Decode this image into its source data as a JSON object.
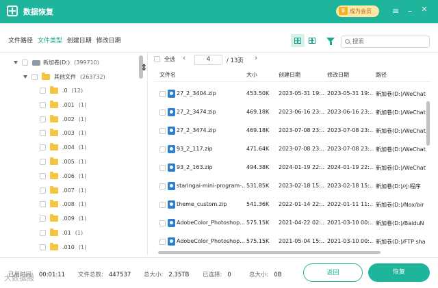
{
  "app": {
    "title": "数据恢复",
    "vip_label": "成为会员"
  },
  "tabs": [
    "文件路径",
    "文件类型",
    "创建日期",
    "修改日期"
  ],
  "search": {
    "placeholder": "搜索"
  },
  "tree": {
    "root": {
      "label": "新加卷(D:)",
      "count": "(399710)"
    },
    "group": {
      "label": "其他文件",
      "count": "(263732)"
    },
    "folders": [
      {
        "label": ".0",
        "count": "(12)"
      },
      {
        "label": ".001",
        "count": "(1)"
      },
      {
        "label": ".002",
        "count": "(1)"
      },
      {
        "label": ".003",
        "count": "(1)"
      },
      {
        "label": ".004",
        "count": "(1)"
      },
      {
        "label": ".005",
        "count": "(1)"
      },
      {
        "label": ".006",
        "count": "(1)"
      },
      {
        "label": ".007",
        "count": "(1)"
      },
      {
        "label": ".008",
        "count": "(1)"
      },
      {
        "label": ".009",
        "count": "(1)"
      },
      {
        "label": ".01",
        "count": "(1)"
      },
      {
        "label": ".010",
        "count": "(1)"
      }
    ]
  },
  "pager": {
    "select_all": "全选",
    "prev": "‹",
    "next": "›",
    "current": "4",
    "total": "/ 13页"
  },
  "columns": {
    "name": "文件名",
    "size": "大小",
    "created": "创建日期",
    "modified": "修改日期",
    "path": "路径"
  },
  "files": [
    {
      "name": "27_2_3404.zip",
      "size": "453.50K",
      "created": "2023-05-31 19:...",
      "modified": "2023-05-31 19:...",
      "path": "新加卷(D:)/WeChat"
    },
    {
      "name": "27_2_3474.zip",
      "size": "469.18K",
      "created": "2023-06-16 23:...",
      "modified": "2023-06-16 23:...",
      "path": "新加卷(D:)/WeChat"
    },
    {
      "name": "27_2_3474.zip",
      "size": "469.18K",
      "created": "2023-07-08 23:...",
      "modified": "2023-07-08 23:...",
      "path": "新加卷(D:)/WeChat"
    },
    {
      "name": "93_2_117.zip",
      "size": "471.64K",
      "created": "2023-07-08 23:...",
      "modified": "2023-07-08 23:...",
      "path": "新加卷(D:)/WeChat"
    },
    {
      "name": "93_2_163.zip",
      "size": "494.38K",
      "created": "2024-01-19 22:...",
      "modified": "2024-01-19 22:...",
      "path": "新加卷(D:)/WeChat"
    },
    {
      "name": "staringai-mini-program-...",
      "size": "531.85K",
      "created": "2023-02-18 15:...",
      "modified": "2023-02-18 15:...",
      "path": "新加卷(D:)/小程序"
    },
    {
      "name": "theme_custom.zip",
      "size": "541.36K",
      "created": "2022-01-14 22:...",
      "modified": "2022-01-11 11:...",
      "path": "新加卷(D:)/Nox/bir"
    },
    {
      "name": "AdobeColor_Photoshop...",
      "size": "575.15K",
      "created": "2021-04-22 02:...",
      "modified": "2021-03-10 00:...",
      "path": "新加卷(D:)/BaiduN"
    },
    {
      "name": "AdobeColor_Photoshop...",
      "size": "575.15K",
      "created": "2021-05-04 15:...",
      "modified": "2021-03-10 00:...",
      "path": "新加卷(D:)/FTP sha"
    }
  ],
  "footer": {
    "elapsed_label": "已用时间:",
    "elapsed": "00:01:11",
    "total_label": "文件总数:",
    "total": "447537",
    "size_label": "总大小:",
    "size": "2.35TB",
    "selected_label": "已选择:",
    "selected": "0",
    "selected_size_label": "总大小:",
    "selected_size": "0B",
    "back_label": "返回",
    "recover_label": "恢复"
  },
  "watermark": "大数据搬"
}
